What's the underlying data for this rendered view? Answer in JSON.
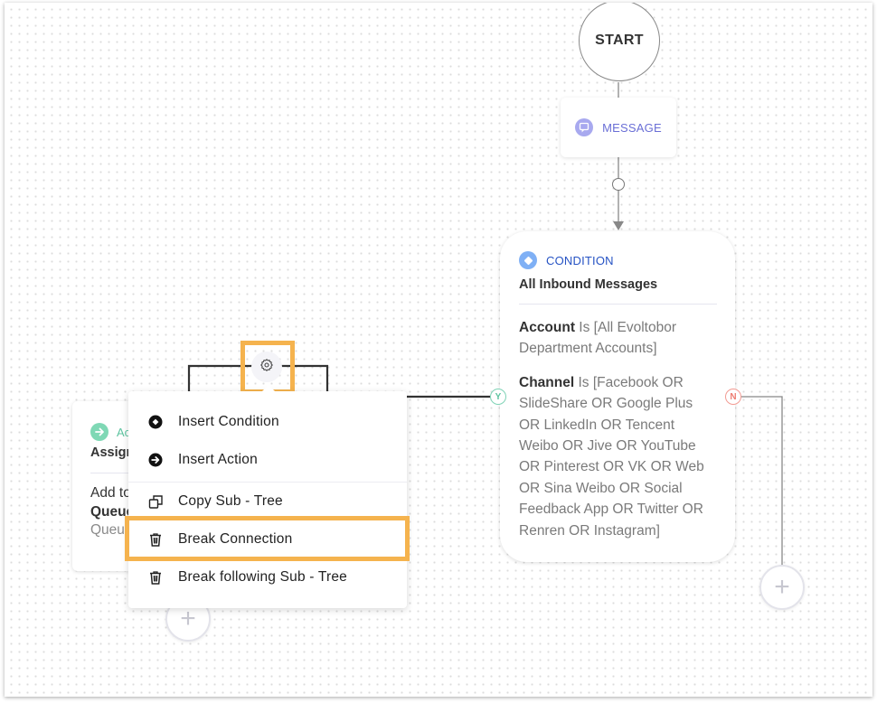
{
  "canvas": {
    "background": "dotted-grid"
  },
  "start_node": {
    "label": "START"
  },
  "message_node": {
    "icon": "chat-bubble-icon",
    "label": "MESSAGE",
    "color": "#6a6fd6"
  },
  "condition_node": {
    "icon": "diamond-icon",
    "type_label": "CONDITION",
    "title": "All Inbound Messages",
    "rules": [
      {
        "field": "Account",
        "text": " Is [All Evoltobor Department Accounts]"
      },
      {
        "field": "Channel",
        "text": " Is [Facebook OR SlideShare OR Google Plus OR LinkedIn OR Tencent Weibo OR Jive OR YouTube OR Pinterest OR VK OR Web OR Sina Weibo OR Social Feedback App OR Twitter OR Renren OR Instagram]"
      }
    ],
    "yes_badge": "Y",
    "no_badge": "N",
    "accent": "#2653c4"
  },
  "action_node": {
    "icon": "arrow-right-circle-icon",
    "type_label": "Ac",
    "title": "Assign",
    "line1": "Add to",
    "line2": "Queue",
    "line3": "Queue",
    "accent": "#5cc39f"
  },
  "gear_button": {
    "icon": "gear-icon",
    "highlighted": true
  },
  "context_menu": {
    "items": [
      {
        "icon": "condition-diamond-icon",
        "label": "Insert Condition"
      },
      {
        "icon": "action-arrow-icon",
        "label": "Insert Action"
      },
      {
        "icon": "copy-icon",
        "label": "Copy Sub - Tree"
      },
      {
        "icon": "trash-icon",
        "label": "Break Connection",
        "highlighted": true
      },
      {
        "icon": "trash-icon",
        "label": "Break following Sub - Tree"
      }
    ]
  },
  "add_buttons": {
    "symbol": "+"
  },
  "highlight_color": "#f5b34e"
}
